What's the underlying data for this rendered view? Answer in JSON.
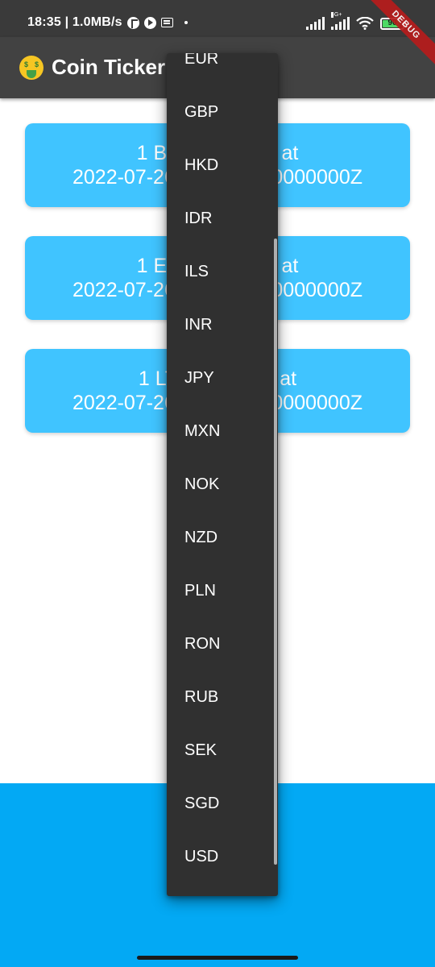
{
  "status_bar": {
    "time_speed": "18:35 | 1.0MB/s",
    "network_label": "4G+",
    "battery": "90",
    "battery_level": 0.9
  },
  "debug_banner": "DEBUG",
  "app_bar": {
    "emoji_icon": "money-mouth-face-icon",
    "title": "Coin Ticker"
  },
  "cards": [
    {
      "line1": "1 BTC = ? USD at",
      "line2": "2022-07-26T00:00:00.0000000Z"
    },
    {
      "line1": "1 ETH = ? USD at",
      "line2": "2022-07-26T00:00:00.0000000Z"
    },
    {
      "line1": "1 LTC = ? USD at",
      "line2": "2022-07-26T00:00:00.0000000Z"
    }
  ],
  "dropdown": {
    "items": [
      "EUR",
      "GBP",
      "HKD",
      "IDR",
      "ILS",
      "INR",
      "JPY",
      "MXN",
      "NOK",
      "NZD",
      "PLN",
      "RON",
      "RUB",
      "SEK",
      "SGD",
      "USD"
    ]
  },
  "colors": {
    "app_bar": "#424242",
    "card": "#40c4ff",
    "bottom": "#03a9f4",
    "menu": "#303030",
    "debug": "#b71c1c"
  }
}
